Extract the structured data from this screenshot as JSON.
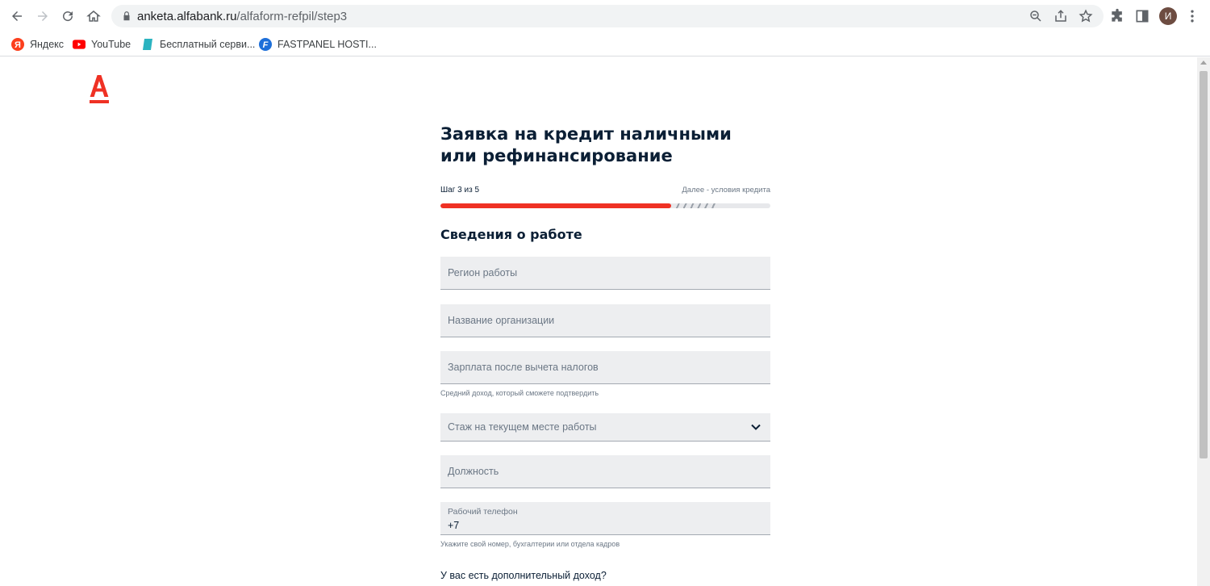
{
  "browser": {
    "url_host": "anketa.alfabank.ru",
    "url_path": "/alfaform-refpil/step3",
    "profile_initial": "И",
    "bookmarks": [
      {
        "label": "Яндекс",
        "icon": "yandex-icon"
      },
      {
        "label": "YouTube",
        "icon": "youtube-icon"
      },
      {
        "label": "Бесплатный серви...",
        "icon": "bookmark-favicon-icon"
      },
      {
        "label": "FASTPANEL HOSTI...",
        "icon": "fastpanel-icon"
      }
    ]
  },
  "colors": {
    "accent": "#ef3124",
    "text": "#0b1f35",
    "field_bg": "#edeef0"
  },
  "form": {
    "title": "Заявка на кредит наличными или рефинансирование",
    "step_label": "Шаг 3 из 5",
    "next_label": "Далее - условия кредита",
    "progress": 0.7,
    "section_title": "Сведения о работе",
    "fields": {
      "region": {
        "placeholder": "Регион работы"
      },
      "organization": {
        "placeholder": "Название организации"
      },
      "salary": {
        "placeholder": "Зарплата после вычета налогов",
        "hint": "Средний доход, который сможете подтвердить"
      },
      "experience": {
        "placeholder": "Стаж на текущем месте работы"
      },
      "position": {
        "placeholder": "Должность"
      },
      "work_phone": {
        "label": "Рабочий телефон",
        "value": "+7",
        "hint": "Укажите свой номер, бухгалтерии или отдела кадров"
      }
    },
    "extra_income_question": "У вас есть дополнительный доход?"
  }
}
